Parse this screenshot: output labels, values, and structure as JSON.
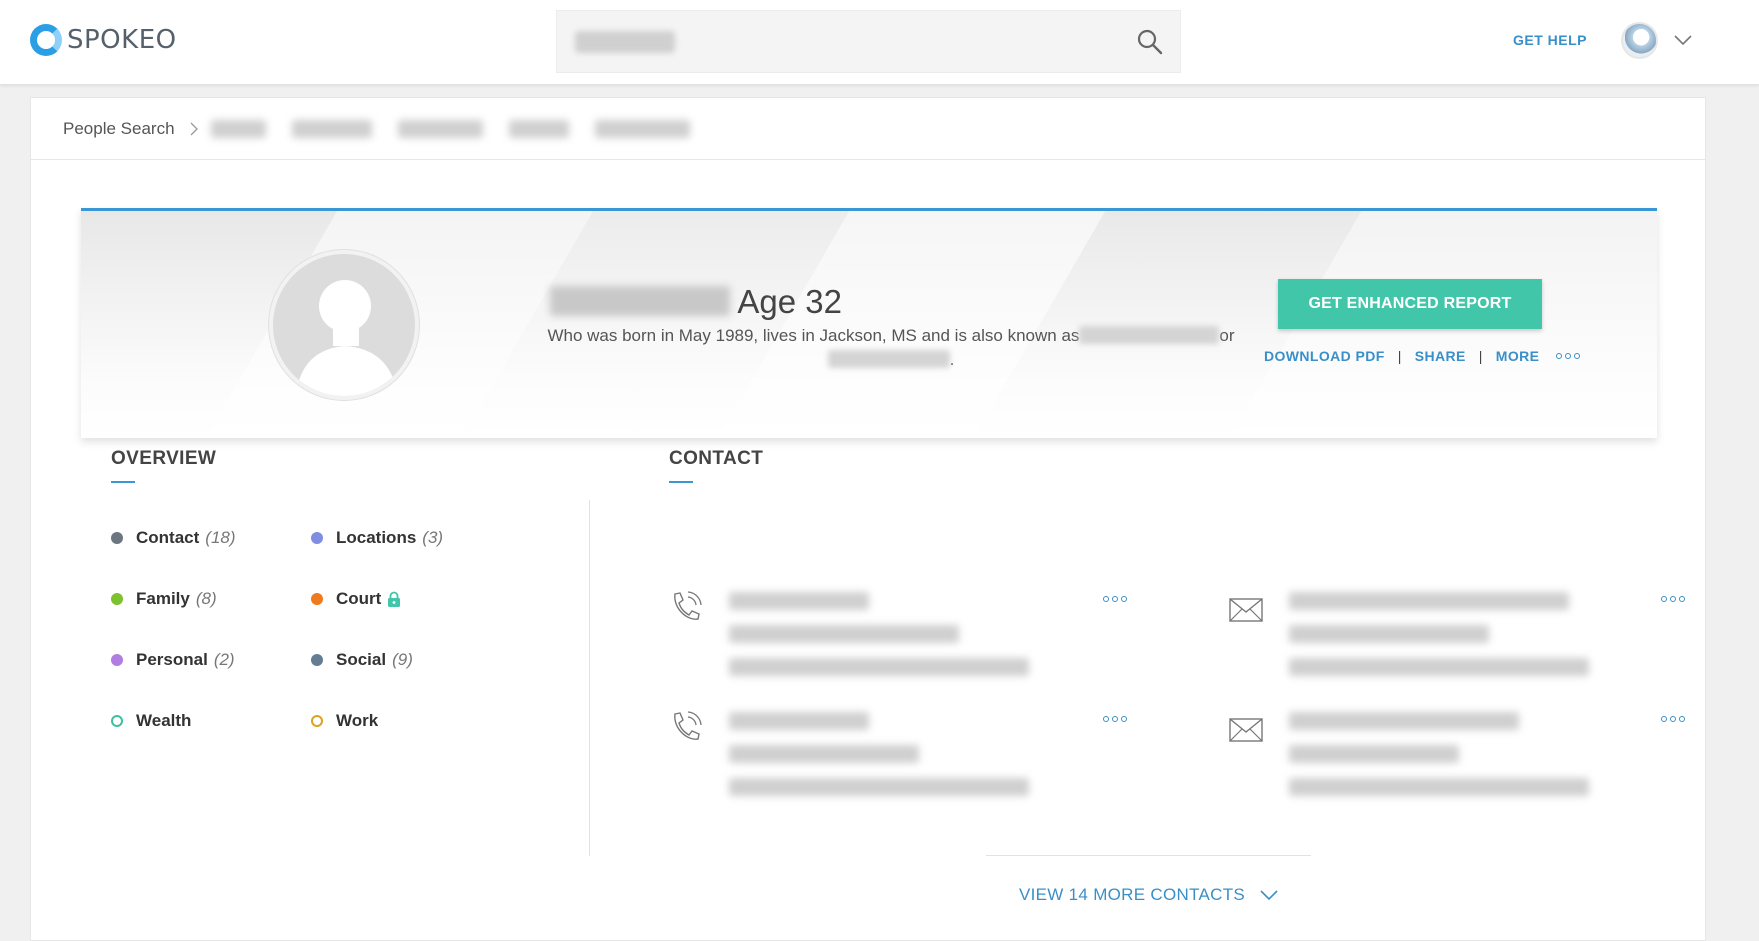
{
  "header": {
    "brand": "SPOKEO",
    "help_label": "GET HELP"
  },
  "breadcrumb": {
    "root": "People Search"
  },
  "profile": {
    "age_text": "Age 32",
    "summary_prefix": "Who was born in May 1989, lives in Jackson, MS and is also known as",
    "summary_or": "or",
    "summary_end": ".",
    "cta_label": "GET ENHANCED REPORT",
    "actions": {
      "download": "DOWNLOAD PDF",
      "share": "SHARE",
      "more": "MORE"
    }
  },
  "overview": {
    "title": "OVERVIEW",
    "items": [
      {
        "label": "Contact",
        "count": "(18)",
        "color": "#6b7680"
      },
      {
        "label": "Locations",
        "count": "(3)",
        "color": "#7f8ee0"
      },
      {
        "label": "Family",
        "count": "(8)",
        "color": "#7cc12e"
      },
      {
        "label": "Court",
        "count": "",
        "color": "#f07a1e"
      },
      {
        "label": "Personal",
        "count": "(2)",
        "color": "#b07ee0"
      },
      {
        "label": "Social",
        "count": "(9)",
        "color": "#657d94"
      },
      {
        "label": "Wealth",
        "count": "",
        "color": "#3fbfa0"
      },
      {
        "label": "Work",
        "count": "",
        "color": "#e0a020"
      }
    ]
  },
  "contact": {
    "title": "CONTACT",
    "view_more_label": "VIEW 14 MORE CONTACTS"
  },
  "colors": {
    "accent": "#3a97d6",
    "cta": "#42c6a9",
    "link": "#3a8fc9"
  }
}
